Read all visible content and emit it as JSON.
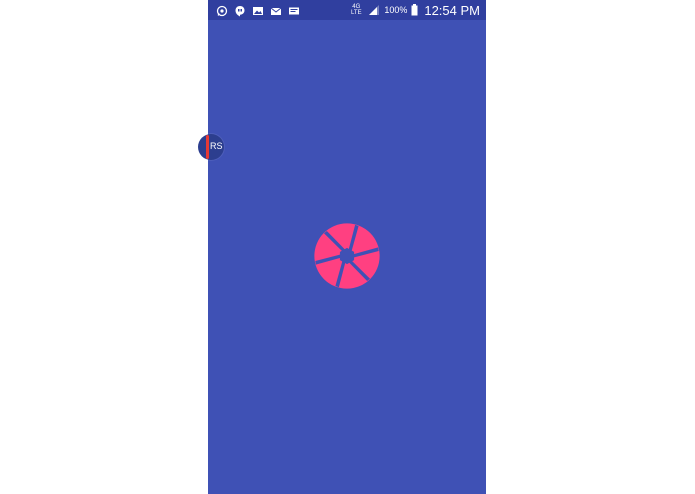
{
  "statusbar": {
    "left_icons": [
      "whatsapp-icon",
      "hangouts-icon",
      "gallery-icon",
      "email-icon",
      "messages-icon"
    ],
    "network_label": "4G LTE",
    "battery_text": "100%",
    "time": "12:54 PM"
  },
  "edge_bubble": {
    "label": "RS"
  },
  "app": {
    "logo_icon": "camera-aperture-icon",
    "colors": {
      "background": "#3F51B5",
      "statusbar": "#303F9F",
      "logo": "#FF4081"
    }
  }
}
